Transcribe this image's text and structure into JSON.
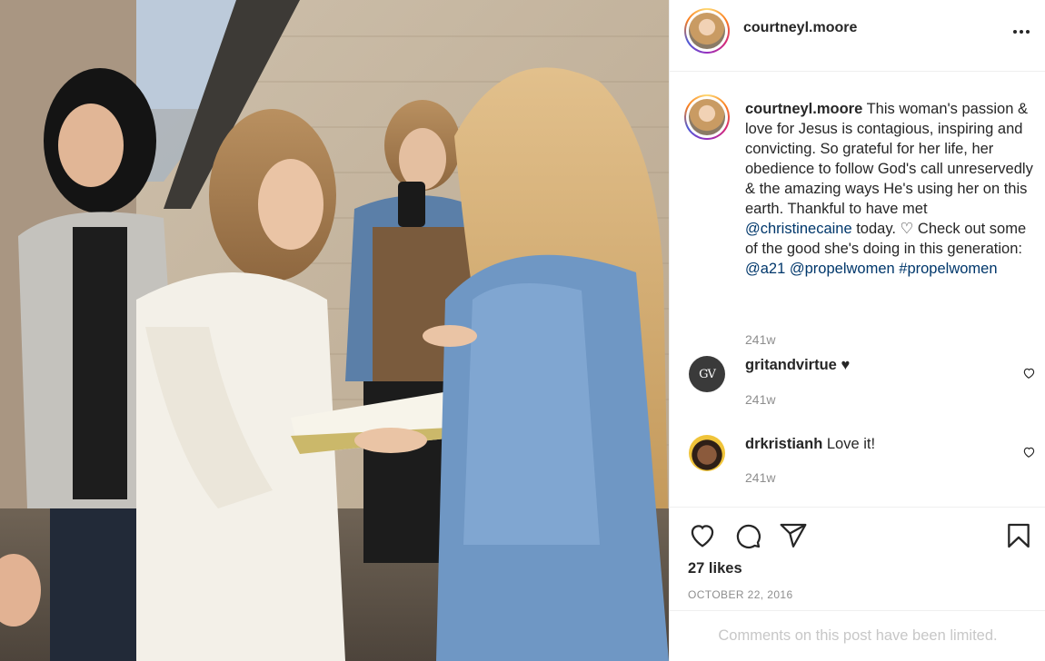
{
  "post": {
    "username": "courtneyl.moore",
    "caption_parts": {
      "text1": " This woman's passion & love for Jesus is contagious, inspiring and convicting. So grateful for her life, her obedience to follow God's call unreservedly & the amazing ways He's using her on this earth. Thankful to have met ",
      "mention1": "@christinecaine",
      "text2": " today. ♡ Check out some of the good she's doing in this generation: ",
      "mention2": "@a21",
      "space": " ",
      "mention3": "@propelwomen",
      "hashtag": "#propelwomen"
    },
    "caption_time": "241w",
    "likes": "27 likes",
    "date": "OCTOBER 22, 2016",
    "comments_limited": "Comments on this post have been limited."
  },
  "comments": [
    {
      "username": "gritandvirtue",
      "text": "♥",
      "time": "241w",
      "avatar_text": "GV"
    },
    {
      "username": "drkristianh",
      "text": "Love it!",
      "time": "241w"
    }
  ],
  "icons": {
    "more": "more-options-icon",
    "like": "heart-icon",
    "comment": "comment-icon",
    "share": "share-icon",
    "save": "bookmark-icon"
  },
  "colors": {
    "text": "#262626",
    "secondary": "#8e8e8e",
    "link": "#00376b",
    "border": "#efefef",
    "disabled": "#c7c7c7"
  }
}
